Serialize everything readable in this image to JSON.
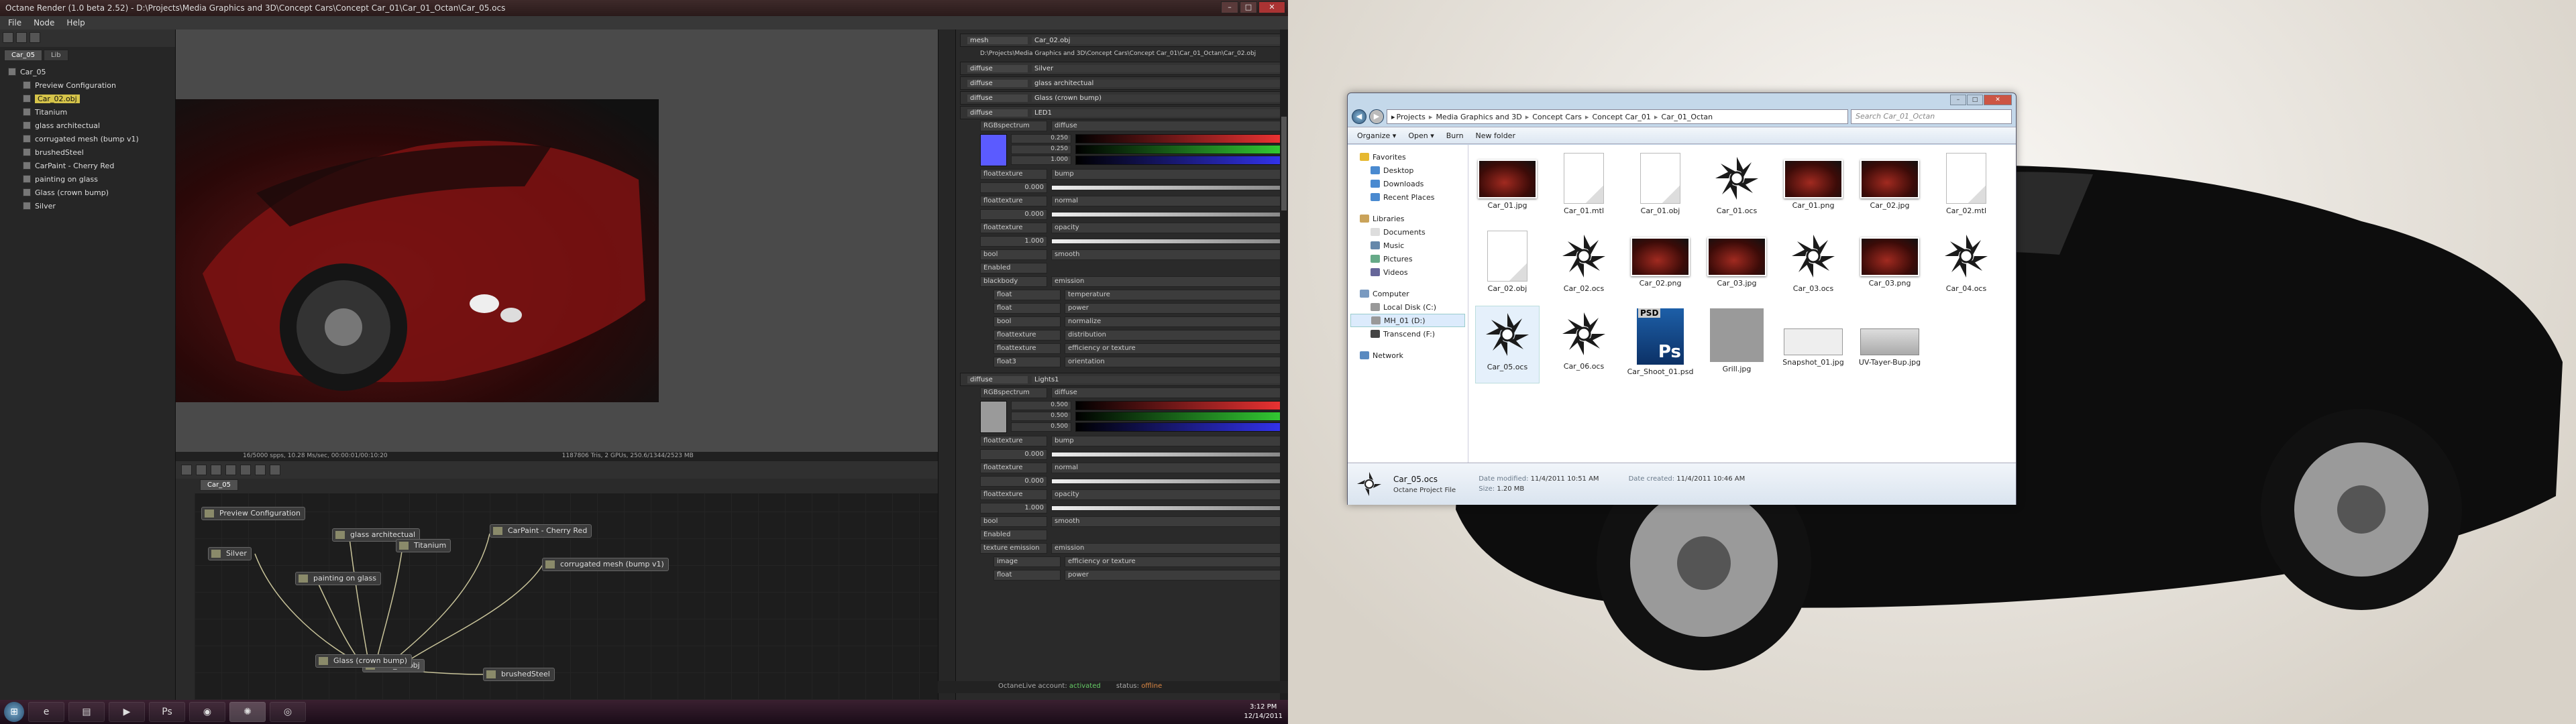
{
  "octane": {
    "title": "Octane Render (1.0 beta 2.52) - D:\\Projects\\Media Graphics and 3D\\Concept Cars\\Concept Car_01\\Car_01_Octan\\Car_05.ocs",
    "menu": [
      "File",
      "Node",
      "Help"
    ],
    "left_tabs": [
      "Car_05",
      "Lib"
    ],
    "scene_root": "Car_05",
    "scene_items": [
      "Preview Configuration",
      "Car_02.obj",
      "Titanium",
      "glass architectual",
      "corrugated mesh (bump v1)",
      "brushedSteel",
      "CarPaint - Cherry Red",
      "painting on glass",
      "Glass (crown bump)",
      "Silver"
    ],
    "viewport_status": "16/5000 spps, 10.28 Ms/sec, 00:00:01/00:10:20",
    "viewport_status_right": "1187806 Tris, 2 GPUs, 250.6/1344/2523 MB",
    "graph_tab": "Car_05",
    "graph_nodes": [
      "Preview Configuration",
      "glass architectual",
      "Titanium",
      "CarPaint - Cherry Red",
      "corrugated mesh (bump v1)",
      "Silver",
      "painting on glass",
      "Car_02.obj",
      "Glass (crown bump)",
      "brushedSteel"
    ],
    "inspector": {
      "mesh_type": "mesh",
      "mesh_name": "Car_02.obj",
      "mesh_path": "D:\\Projects\\Media Graphics and 3D\\Concept Cars\\Concept Car_01\\Car_01_Octan\\Car_02.obj",
      "materials": [
        {
          "type": "diffuse",
          "name": "Silver"
        },
        {
          "type": "diffuse",
          "name": "glass architectual"
        },
        {
          "type": "diffuse",
          "name": "Glass (crown bump)"
        },
        {
          "type": "diffuse",
          "name": "LED1"
        }
      ],
      "led1_diffuse": {
        "type": "RGBspectrum",
        "name": "diffuse",
        "r": "0.250",
        "g": "0.250",
        "b": "1.000",
        "color": "#5b5bff"
      },
      "led1_rows": [
        {
          "type": "floattexture",
          "name": "bump",
          "value": "0.000"
        },
        {
          "type": "floattexture",
          "name": "normal",
          "value": "0.000"
        },
        {
          "type": "floattexture",
          "name": "opacity",
          "value": "1.000"
        },
        {
          "type": "bool",
          "name": "smooth",
          "value": "Enabled"
        },
        {
          "type": "blackbody",
          "name": "emission"
        }
      ],
      "emission_rows": [
        {
          "type": "float",
          "name": "temperature"
        },
        {
          "type": "float",
          "name": "power"
        },
        {
          "type": "bool",
          "name": "normalize"
        },
        {
          "type": "floattexture",
          "name": "distribution"
        },
        {
          "type": "floattexture",
          "name": "efficiency or texture"
        },
        {
          "type": "float3",
          "name": "orientation"
        }
      ],
      "lights1": {
        "type": "diffuse",
        "name": "Lights1"
      },
      "lights1_diffuse": {
        "type": "RGBspectrum",
        "name": "diffuse",
        "r": "0.500",
        "g": "0.500",
        "b": "0.500",
        "color": "#9a9a9a"
      },
      "lights1_rows": [
        {
          "type": "floattexture",
          "name": "bump",
          "value": "0.000"
        },
        {
          "type": "floattexture",
          "name": "normal",
          "value": "0.000"
        },
        {
          "type": "floattexture",
          "name": "opacity",
          "value": "1.000"
        },
        {
          "type": "bool",
          "name": "smooth",
          "value": "Enabled"
        },
        {
          "type": "texture emission",
          "name": "emission"
        }
      ],
      "tex_emission_rows": [
        {
          "type": "image",
          "name": "efficiency or texture"
        },
        {
          "type": "float",
          "name": "power"
        }
      ]
    },
    "account_label": "OctaneLive account:",
    "account_status": "activated",
    "status_label": "status:",
    "status_value": "offline"
  },
  "taskbar1": {
    "time": "3:12 PM",
    "date": "12/14/2011"
  },
  "explorer": {
    "breadcrumb": [
      "Projects",
      "Media Graphics and 3D",
      "Concept Cars",
      "Concept Car_01",
      "Car_01_Octan"
    ],
    "search_placeholder": "Search Car_01_Octan",
    "commands": [
      "Organize ▾",
      "Open ▾",
      "Burn",
      "New folder"
    ],
    "nav": {
      "favorites": "Favorites",
      "fav_items": [
        "Desktop",
        "Downloads",
        "Recent Places"
      ],
      "libraries": "Libraries",
      "lib_items": [
        "Documents",
        "Music",
        "Pictures",
        "Videos"
      ],
      "computer": "Computer",
      "comp_items": [
        "Local Disk (C:)",
        "MH_01 (D:)",
        "Transcend (F:)"
      ],
      "network": "Network"
    },
    "files": [
      {
        "name": "Car_01.jpg",
        "kind": "img"
      },
      {
        "name": "Car_01.mtl",
        "kind": "doc"
      },
      {
        "name": "Car_01.obj",
        "kind": "doc"
      },
      {
        "name": "Car_01.ocs",
        "kind": "oct"
      },
      {
        "name": "Car_01.png",
        "kind": "img"
      },
      {
        "name": "Car_02.jpg",
        "kind": "img"
      },
      {
        "name": "Car_02.mtl",
        "kind": "doc"
      },
      {
        "name": "Car_02.obj",
        "kind": "doc"
      },
      {
        "name": "Car_02.ocs",
        "kind": "oct"
      },
      {
        "name": "Car_02.png",
        "kind": "img"
      },
      {
        "name": "Car_03.jpg",
        "kind": "img"
      },
      {
        "name": "Car_03.ocs",
        "kind": "oct"
      },
      {
        "name": "Car_03.png",
        "kind": "img"
      },
      {
        "name": "Car_04.ocs",
        "kind": "oct"
      },
      {
        "name": "Car_05.ocs",
        "kind": "oct"
      },
      {
        "name": "Car_06.ocs",
        "kind": "oct"
      },
      {
        "name": "Car_Shoot_01.psd",
        "kind": "psd"
      },
      {
        "name": "Grill.jpg",
        "kind": "grey"
      },
      {
        "name": "Snapshot_01.jpg",
        "kind": "snap"
      },
      {
        "name": "UV-Tayer-Bup.jpg",
        "kind": "uv"
      }
    ],
    "details": {
      "name": "Car_05.ocs",
      "type": "Octane Project File",
      "modified_label": "Date modified:",
      "modified": "11/4/2011 10:51 AM",
      "size_label": "Size:",
      "size": "1.20 MB",
      "created_label": "Date created:",
      "created": "11/4/2011 10:46 AM"
    }
  },
  "colors": {
    "accent": "#d6c44a",
    "online": "#66cc66",
    "offline": "#dd8844"
  }
}
